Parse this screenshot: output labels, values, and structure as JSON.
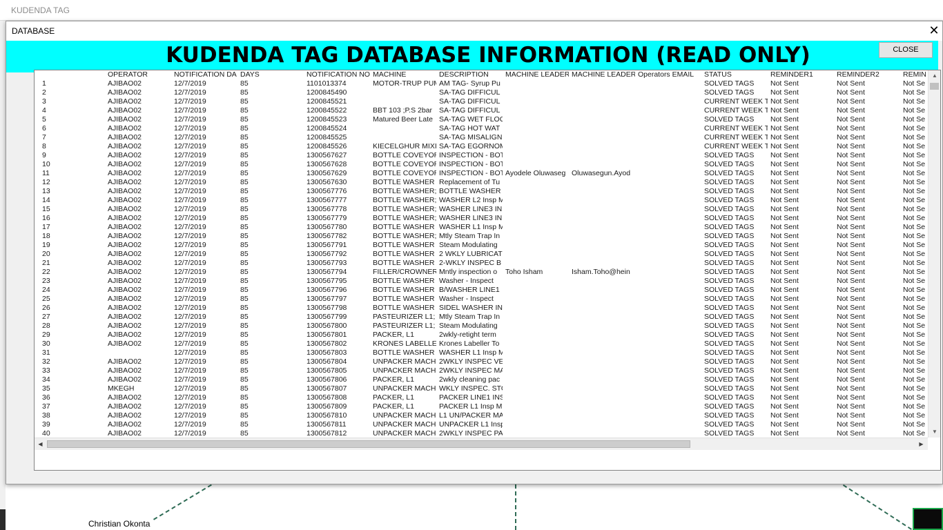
{
  "background": {
    "app_title": "KUDENDA TAG",
    "node_name": "Christian Okonta"
  },
  "dialog": {
    "title": "DATABASE",
    "close_x": "✕",
    "banner": "KUDENDA TAG DATABASE INFORMATION (READ ONLY)",
    "close_button": "CLOSE"
  },
  "table": {
    "headers": [
      "",
      "OPERATOR",
      "NOTIFICATION DA",
      "DAYS",
      "NOTIFICATION NO",
      "MACHINE",
      "DESCRIPTION",
      "MACHINE LEADER",
      "MACHINE LEADER",
      "Operators EMAIL",
      "STATUS",
      "REMINDER1",
      "REMINDER2",
      "REMIN"
    ],
    "rows": [
      [
        "1",
        "AJIBAO02",
        "12/7/2019",
        "85",
        "1101013374",
        "MOTOR-TRUP PUMP",
        "AM TAG- Syrup Pu",
        "",
        "",
        "",
        "SOLVED TAGS",
        "Not Sent",
        "Not Sent",
        "Not Se"
      ],
      [
        "2",
        "AJIBAO02",
        "12/7/2019",
        "85",
        "1200845490",
        "",
        "SA-TAG DIFFICUL",
        "",
        "",
        "",
        "SOLVED TAGS",
        "Not Sent",
        "Not Sent",
        "Not Se"
      ],
      [
        "3",
        "AJIBAO02",
        "12/7/2019",
        "85",
        "1200845521",
        "",
        "SA-TAG DIFFICUL",
        "",
        "",
        "",
        "CURRENT WEEK T",
        "Not Sent",
        "Not Sent",
        "Not Se"
      ],
      [
        "4",
        "AJIBAO02",
        "12/7/2019",
        "85",
        "1200845522",
        "BBT 103 ;P.S 2bar",
        "SA-TAG DIFFICUL",
        "",
        "",
        "",
        "CURRENT WEEK T",
        "Not Sent",
        "Not Sent",
        "Not Se"
      ],
      [
        "5",
        "AJIBAO02",
        "12/7/2019",
        "85",
        "1200845523",
        "Matured Beer Late",
        "SA-TAG WET FLOO",
        "",
        "",
        "",
        "SOLVED TAGS",
        "Not Sent",
        "Not Sent",
        "Not Se"
      ],
      [
        "6",
        "AJIBAO02",
        "12/7/2019",
        "85",
        "1200845524",
        "",
        "SA-TAG HOT WAT",
        "",
        "",
        "",
        "CURRENT WEEK T",
        "Not Sent",
        "Not Sent",
        "Not Se"
      ],
      [
        "7",
        "AJIBAO02",
        "12/7/2019",
        "85",
        "1200845525",
        "",
        "SA-TAG MISALIGN",
        "",
        "",
        "",
        "CURRENT WEEK T",
        "Not Sent",
        "Not Sent",
        "Not Se"
      ],
      [
        "8",
        "AJIBAO02",
        "12/7/2019",
        "85",
        "1200845526",
        "KIECELGHUR MIXI",
        "SA-TAG EGORNOM",
        "",
        "",
        "",
        "CURRENT WEEK T",
        "Not Sent",
        "Not Sent",
        "Not Se"
      ],
      [
        "9",
        "AJIBAO02",
        "12/7/2019",
        "85",
        "1300567627",
        "BOTTLE COVEYOR",
        "INSPECTION - BOT",
        "",
        "",
        "",
        "SOLVED TAGS",
        "Not Sent",
        "Not Sent",
        "Not Se"
      ],
      [
        "10",
        "AJIBAO02",
        "12/7/2019",
        "85",
        "1300567628",
        "BOTTLE COVEYOR",
        "INSPECTION - BOT",
        "",
        "",
        "",
        "SOLVED TAGS",
        "Not Sent",
        "Not Sent",
        "Not Se"
      ],
      [
        "11",
        "AJIBAO02",
        "12/7/2019",
        "85",
        "1300567629",
        "BOTTLE COVEYOR",
        "INSPECTION - BOT",
        "Ayodele Oluwaseg",
        "Oluwasegun.Ayod",
        "",
        "SOLVED TAGS",
        "Not Sent",
        "Not Sent",
        "Not Se"
      ],
      [
        "12",
        "AJIBAO02",
        "12/7/2019",
        "85",
        "1300567630",
        "BOTTLE WASHER",
        "Replacement of Tu",
        "",
        "",
        "",
        "SOLVED TAGS",
        "Not Sent",
        "Not Sent",
        "Not Se"
      ],
      [
        "13",
        "AJIBAO02",
        "12/7/2019",
        "85",
        "1300567776",
        "BOTTLE WASHER;",
        "BOTTLE WASHER",
        "",
        "",
        "",
        "SOLVED TAGS",
        "Not Sent",
        "Not Sent",
        "Not Se"
      ],
      [
        "14",
        "AJIBAO02",
        "12/7/2019",
        "85",
        "1300567777",
        "BOTTLE WASHER;",
        "WASHER L2 Insp M",
        "",
        "",
        "",
        "SOLVED TAGS",
        "Not Sent",
        "Not Sent",
        "Not Se"
      ],
      [
        "15",
        "AJIBAO02",
        "12/7/2019",
        "85",
        "1300567778",
        "BOTTLE WASHER;",
        "WASHER LINE3 IN",
        "",
        "",
        "",
        "SOLVED TAGS",
        "Not Sent",
        "Not Sent",
        "Not Se"
      ],
      [
        "16",
        "AJIBAO02",
        "12/7/2019",
        "85",
        "1300567779",
        "BOTTLE WASHER;",
        "WASHER LINE3 IN",
        "",
        "",
        "",
        "SOLVED TAGS",
        "Not Sent",
        "Not Sent",
        "Not Se"
      ],
      [
        "17",
        "AJIBAO02",
        "12/7/2019",
        "85",
        "1300567780",
        "BOTTLE WASHER",
        "WASHER L1 Insp M",
        "",
        "",
        "",
        "SOLVED TAGS",
        "Not Sent",
        "Not Sent",
        "Not Se"
      ],
      [
        "18",
        "AJIBAO02",
        "12/7/2019",
        "85",
        "1300567782",
        "BOTTLE WASHER;",
        "Mtly Steam Trap In",
        "",
        "",
        "",
        "SOLVED TAGS",
        "Not Sent",
        "Not Sent",
        "Not Se"
      ],
      [
        "19",
        "AJIBAO02",
        "12/7/2019",
        "85",
        "1300567791",
        "BOTTLE WASHER",
        "Steam Modulating",
        "",
        "",
        "",
        "SOLVED TAGS",
        "Not Sent",
        "Not Sent",
        "Not Se"
      ],
      [
        "20",
        "AJIBAO02",
        "12/7/2019",
        "85",
        "1300567792",
        "BOTTLE WASHER",
        "2 WKLY LUBRICAT",
        "",
        "",
        "",
        "SOLVED TAGS",
        "Not Sent",
        "Not Sent",
        "Not Se"
      ],
      [
        "21",
        "AJIBAO02",
        "12/7/2019",
        "85",
        "1300567793",
        "BOTTLE WASHER",
        "2-WKLY INSPEC B",
        "",
        "",
        "",
        "SOLVED TAGS",
        "Not Sent",
        "Not Sent",
        "Not Se"
      ],
      [
        "22",
        "AJIBAO02",
        "12/7/2019",
        "85",
        "1300567794",
        "FILLER/CROWNER",
        "Mntly inspection o",
        "Toho Isham",
        "Isham.Toho@hein",
        "",
        "SOLVED TAGS",
        "Not Sent",
        "Not Sent",
        "Not Se"
      ],
      [
        "23",
        "AJIBAO02",
        "12/7/2019",
        "85",
        "1300567795",
        "BOTTLE WASHER",
        "Washer - Inspect",
        "",
        "",
        "",
        "SOLVED TAGS",
        "Not Sent",
        "Not Sent",
        "Not Se"
      ],
      [
        "24",
        "AJIBAO02",
        "12/7/2019",
        "85",
        "1300567796",
        "BOTTLE WASHER",
        "B/WASHER LINE1",
        "",
        "",
        "",
        "SOLVED TAGS",
        "Not Sent",
        "Not Sent",
        "Not Se"
      ],
      [
        "25",
        "AJIBAO02",
        "12/7/2019",
        "85",
        "1300567797",
        "BOTTLE WASHER",
        "Washer - Inspect",
        "",
        "",
        "",
        "SOLVED TAGS",
        "Not Sent",
        "Not Sent",
        "Not Se"
      ],
      [
        "26",
        "AJIBAO02",
        "12/7/2019",
        "85",
        "1300567798",
        "BOTTLE WASHER",
        "SIDEL WASHER IN",
        "",
        "",
        "",
        "SOLVED TAGS",
        "Not Sent",
        "Not Sent",
        "Not Se"
      ],
      [
        "27",
        "AJIBAO02",
        "12/7/2019",
        "85",
        "1300567799",
        "PASTEURIZER L1;",
        "Mtly Steam Trap In",
        "",
        "",
        "",
        "SOLVED TAGS",
        "Not Sent",
        "Not Sent",
        "Not Se"
      ],
      [
        "28",
        "AJIBAO02",
        "12/7/2019",
        "85",
        "1300567800",
        "PASTEURIZER L1;",
        "Steam Modulating",
        "",
        "",
        "",
        "SOLVED TAGS",
        "Not Sent",
        "Not Sent",
        "Not Se"
      ],
      [
        "29",
        "AJIBAO02",
        "12/7/2019",
        "85",
        "1300567801",
        "PACKER, L1",
        "2wkly-retight term",
        "",
        "",
        "",
        "SOLVED TAGS",
        "Not Sent",
        "Not Sent",
        "Not Se"
      ],
      [
        "30",
        "AJIBAO02",
        "12/7/2019",
        "85",
        "1300567802",
        "KRONES LABELLER",
        "Krones Labeller To",
        "",
        "",
        "",
        "SOLVED TAGS",
        "Not Sent",
        "Not Sent",
        "Not Se"
      ],
      [
        "31",
        "",
        "12/7/2019",
        "85",
        "1300567803",
        "BOTTLE WASHER",
        "WASHER L1 Insp M",
        "",
        "",
        "",
        "SOLVED TAGS",
        "Not Sent",
        "Not Sent",
        "Not Se"
      ],
      [
        "32",
        "AJIBAO02",
        "12/7/2019",
        "85",
        "1300567804",
        "UNPACKER MACHI",
        "2WKLY INSPEC VE",
        "",
        "",
        "",
        "SOLVED TAGS",
        "Not Sent",
        "Not Sent",
        "Not Se"
      ],
      [
        "33",
        "AJIBAO02",
        "12/7/2019",
        "85",
        "1300567805",
        "UNPACKER MACHI",
        "2WKLY INSPEC MA",
        "",
        "",
        "",
        "SOLVED TAGS",
        "Not Sent",
        "Not Sent",
        "Not Se"
      ],
      [
        "34",
        "AJIBAO02",
        "12/7/2019",
        "85",
        "1300567806",
        "PACKER, L1",
        "2wkly cleaning pac",
        "",
        "",
        "",
        "SOLVED TAGS",
        "Not Sent",
        "Not Sent",
        "Not Se"
      ],
      [
        "35",
        "MKEGH",
        "12/7/2019",
        "85",
        "1300567807",
        "UNPACKER MACHI",
        "WKLY INSPEC. STO",
        "",
        "",
        "",
        "SOLVED TAGS",
        "Not Sent",
        "Not Sent",
        "Not Se"
      ],
      [
        "36",
        "AJIBAO02",
        "12/7/2019",
        "85",
        "1300567808",
        "PACKER, L1",
        "PACKER LINE1 INS",
        "",
        "",
        "",
        "SOLVED TAGS",
        "Not Sent",
        "Not Sent",
        "Not Se"
      ],
      [
        "37",
        "AJIBAO02",
        "12/7/2019",
        "85",
        "1300567809",
        "PACKER, L1",
        "PACKER L1 Insp M",
        "",
        "",
        "",
        "SOLVED TAGS",
        "Not Sent",
        "Not Sent",
        "Not Se"
      ],
      [
        "38",
        "AJIBAO02",
        "12/7/2019",
        "85",
        "1300567810",
        "UNPACKER MACHI",
        "L1 UN/PACKER MA",
        "",
        "",
        "",
        "SOLVED TAGS",
        "Not Sent",
        "Not Sent",
        "Not Se"
      ],
      [
        "39",
        "AJIBAO02",
        "12/7/2019",
        "85",
        "1300567811",
        "UNPACKER MACHI",
        "UNPACKER L1 Insp",
        "",
        "",
        "",
        "SOLVED TAGS",
        "Not Sent",
        "Not Sent",
        "Not Se"
      ],
      [
        "40",
        "AJIBAO02",
        "12/7/2019",
        "85",
        "1300567812",
        "UNPACKER MACHI",
        "2WKLY INSPEC PA",
        "",
        "",
        "",
        "SOLVED TAGS",
        "Not Sent",
        "Not Sent",
        "Not Se"
      ]
    ]
  },
  "scrollbars": {
    "up_arrow": "▲",
    "down_arrow": "▼",
    "left_arrow": "◀",
    "right_arrow": "▶"
  },
  "colors": {
    "banner": "#00ffff",
    "dialog_bg": "#f0f0f0",
    "dashed_line": "#2e6b55"
  }
}
